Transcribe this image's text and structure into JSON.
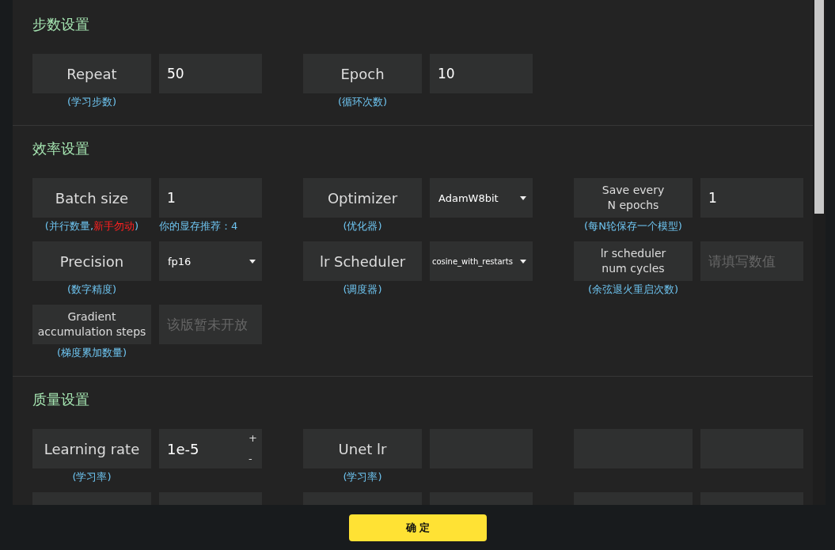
{
  "sections": [
    {
      "title": "步数设置",
      "items": [
        {
          "kind": "text",
          "label": "Repeat",
          "caption": [
            {
              "text": "(学习步数)",
              "warning": false
            }
          ],
          "value": "50"
        },
        {
          "kind": "text",
          "label": "Epoch",
          "caption": [
            {
              "text": "(循环次数)",
              "warning": false
            }
          ],
          "value": "10"
        }
      ]
    },
    {
      "title": "效率设置",
      "items": [
        {
          "kind": "text",
          "label": "Batch size",
          "caption": [
            {
              "text": "(并行数量,",
              "warning": false
            },
            {
              "text": "新手勿动",
              "warning": true
            },
            {
              "text": ")",
              "warning": false
            }
          ],
          "value": "1",
          "note": "你的显存推荐：4"
        },
        {
          "kind": "select",
          "label": "Optimizer",
          "caption": [
            {
              "text": "(优化器)",
              "warning": false
            }
          ],
          "value": "AdamW8bit"
        },
        {
          "kind": "text",
          "label": "Save every\nN epochs",
          "compact": true,
          "caption": [
            {
              "text": "(每N轮保存一个模型)",
              "warning": false
            }
          ],
          "value": "1"
        },
        {
          "kind": "select",
          "label": "Precision",
          "caption": [
            {
              "text": "(数字精度)",
              "warning": false
            }
          ],
          "value": "fp16"
        },
        {
          "kind": "select",
          "label": "lr Scheduler",
          "caption": [
            {
              "text": "(调度器)",
              "warning": false
            }
          ],
          "value": "cosine_with_restarts",
          "small": true
        },
        {
          "kind": "text",
          "label": "lr scheduler\nnum cycles",
          "compact": true,
          "caption": [
            {
              "text": "(余弦退火重启次数)",
              "warning": false
            }
          ],
          "placeholder": "请填写数值"
        },
        {
          "kind": "text",
          "label": "Gradient\naccumulation steps",
          "compact": true,
          "caption": [
            {
              "text": "(梯度累加数量)",
              "warning": false
            }
          ],
          "placeholder": "该版暂未开放"
        }
      ]
    },
    {
      "title": "质量设置",
      "items": [
        {
          "kind": "number",
          "label": "Learning rate",
          "caption": [
            {
              "text": "(学习率)",
              "warning": false
            }
          ],
          "value": "1e-5",
          "stepper": [
            "+",
            "-"
          ]
        },
        {
          "kind": "text",
          "label": "Unet lr",
          "caption": [
            {
              "text": "(学习率)",
              "warning": false
            }
          ]
        },
        {
          "kind": "blank"
        },
        {
          "kind": "blank"
        },
        {
          "kind": "blank"
        },
        {
          "kind": "blank"
        }
      ]
    }
  ],
  "confirm_button": "确 定"
}
